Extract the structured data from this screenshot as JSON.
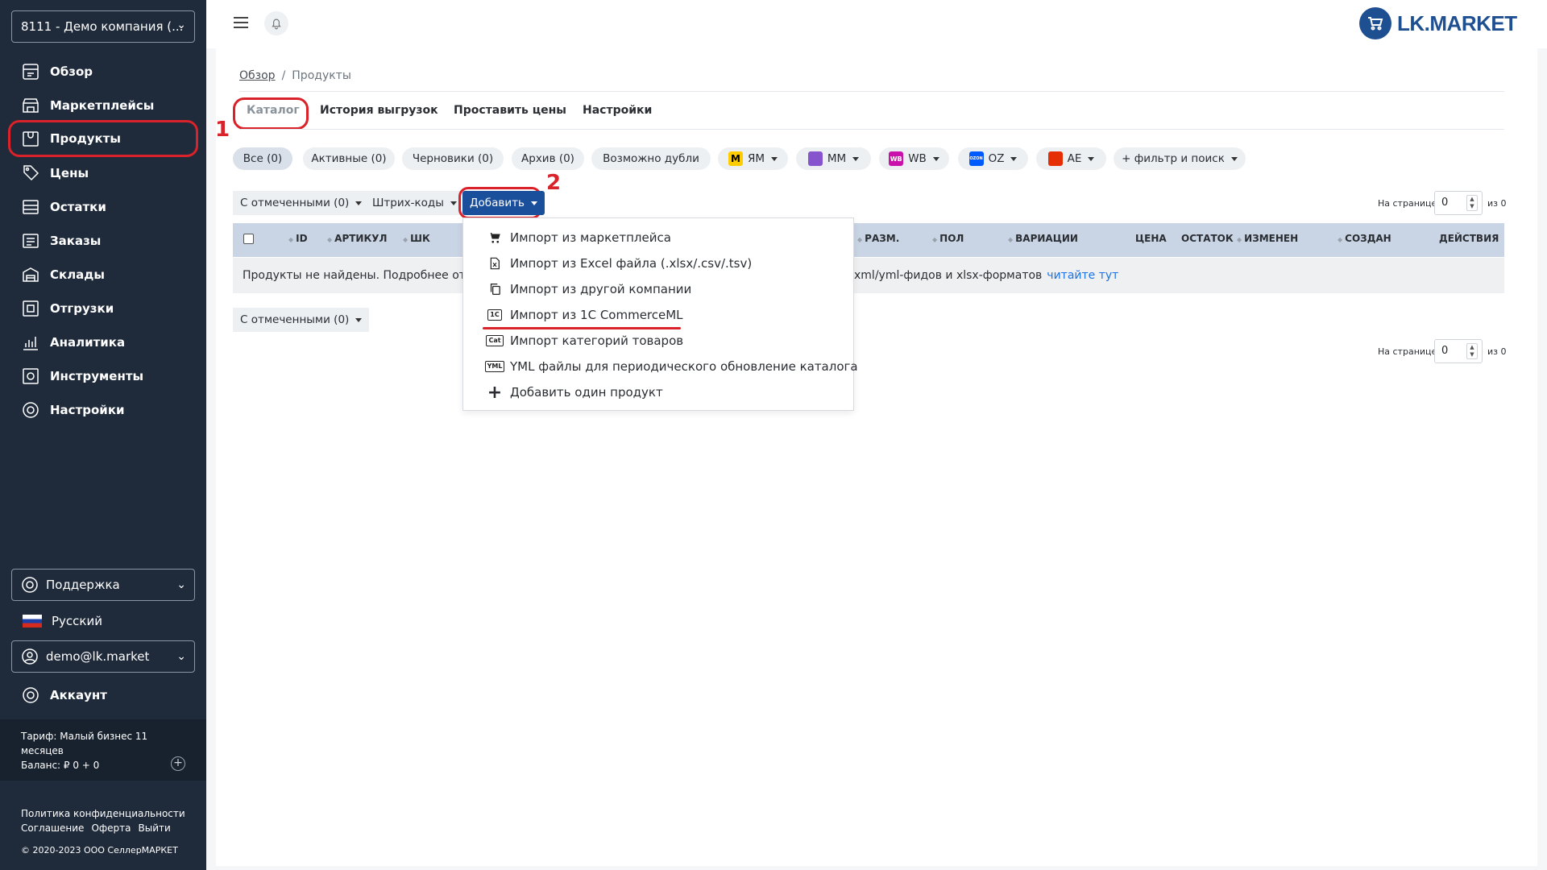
{
  "sidebar": {
    "company": "8111 - Демо компания (...",
    "nav": [
      {
        "label": "Обзор",
        "icon": "dashboard-icon"
      },
      {
        "label": "Маркетплейсы",
        "icon": "marketplace-icon"
      },
      {
        "label": "Продукты",
        "icon": "products-icon"
      },
      {
        "label": "Цены",
        "icon": "prices-icon"
      },
      {
        "label": "Остатки",
        "icon": "stock-icon"
      },
      {
        "label": "Заказы",
        "icon": "orders-icon"
      },
      {
        "label": "Склады",
        "icon": "warehouse-icon"
      },
      {
        "label": "Отгрузки",
        "icon": "shipments-icon"
      },
      {
        "label": "Аналитика",
        "icon": "analytics-icon"
      },
      {
        "label": "Инструменты",
        "icon": "tools-icon"
      },
      {
        "label": "Настройки",
        "icon": "settings-icon"
      }
    ],
    "support": "Поддержка",
    "language": "Русский",
    "user": "demo@lk.market",
    "account": "Аккаунт",
    "tariff_line1": "Тариф: Малый бизнес 11",
    "tariff_line2": "месяцев",
    "balance": "Баланс: ₽ 0 + 0",
    "privacy": "Политика конфиденциальности",
    "agreement": "Соглашение",
    "offer": "Оферта",
    "logout": "Выйти",
    "copyright": "© 2020-2023 ООО СеллерМАРКЕТ"
  },
  "header": {
    "logo_text": "LK.MARKET",
    "colors": {
      "brand": "#1e4f91",
      "sidebar": "#1f2a3a",
      "accent": "#1a4f9c",
      "highlight": "#d9222a"
    }
  },
  "breadcrumb": {
    "home": "Обзор",
    "separator": "/",
    "current": "Продукты"
  },
  "tabs": [
    "Каталог",
    "История выгрузок",
    "Проставить цены",
    "Настройки"
  ],
  "filters": {
    "all": "Все (0)",
    "active": "Активные (0)",
    "drafts": "Черновики (0)",
    "archive": "Архив (0)",
    "duplicates": "Возможно дубли",
    "marketplaces": [
      {
        "label": "ЯМ",
        "badge": "",
        "color": "#ffcc00"
      },
      {
        "label": "ММ",
        "badge": "",
        "color": "#8654cc"
      },
      {
        "label": "WB",
        "badge": "WB",
        "color": "#cb11ab"
      },
      {
        "label": "OZ",
        "badge": "OZON",
        "color": "#005bff"
      },
      {
        "label": "AE",
        "badge": "",
        "color": "#e62e04"
      }
    ],
    "search": "+ фильтр и поиск"
  },
  "toolbar": {
    "selected": "С отмеченными (0)",
    "barcodes": "Штрих-коды",
    "add": "Добавить",
    "per_page_label": "На странице",
    "per_page_value": "0",
    "of_label": "из 0"
  },
  "table": {
    "headers": [
      "ID",
      "АРТИКУЛ",
      "ШК",
      "РАЗМ.",
      "ПОЛ",
      "ВАРИАЦИИ",
      "ЦЕНА",
      "ОСТАТОК",
      "ИЗМЕНЕН",
      "СОЗДАН",
      "ДЕЙСТВИЯ"
    ],
    "empty_start": "Продукты не найдены. Подробнее от том",
    "empty_end": "xml/yml-фидов и xlsx-форматов",
    "empty_link": "читайте тут"
  },
  "dropdown": [
    {
      "label": "Импорт из маркетплейса",
      "icon": "cart-icon"
    },
    {
      "label": "Импорт из Excel файла (.xlsx/.csv/.tsv)",
      "icon": "excel-file-icon"
    },
    {
      "label": "Импорт из другой компании",
      "icon": "copy-icon"
    },
    {
      "label": "Импорт из 1С CommerceML",
      "icon": "1c-icon",
      "badge": "1C"
    },
    {
      "label": "Импорт категорий товаров",
      "icon": "category-icon",
      "badge": "Cat"
    },
    {
      "label": "YML файлы для периодического обновление каталога",
      "icon": "yml-icon",
      "badge": "YML"
    },
    {
      "label": "Добавить один продукт",
      "icon": "plus-icon"
    }
  ],
  "annotations": [
    "1",
    "2"
  ]
}
